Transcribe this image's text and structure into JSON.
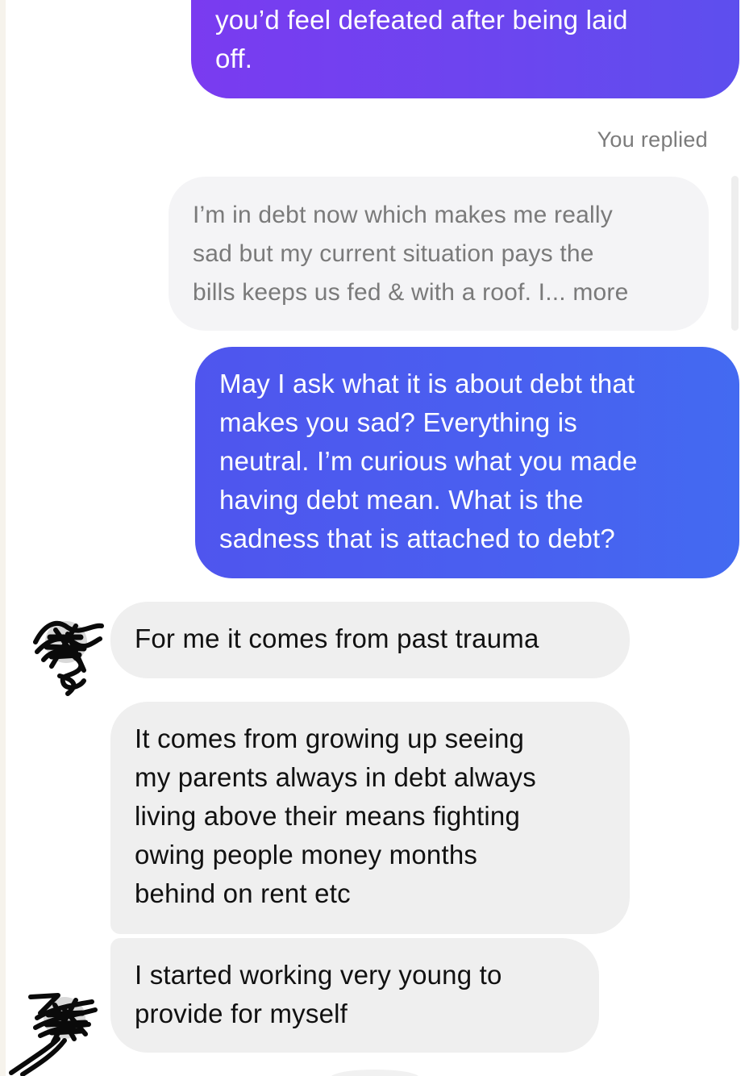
{
  "conversation": {
    "messages": [
      {
        "sender": "me",
        "text": "you’d feel defeated after being laid\noff."
      },
      {
        "sender": "me",
        "kind": "reply-quote",
        "label": "You replied",
        "text": "I’m in debt now which makes me really\nsad but my current situation pays the\nbills keeps us fed & with a roof. I... more"
      },
      {
        "sender": "me",
        "text": "May I ask what it is about debt that\nmakes you sad? Everything is\nneutral. I’m curious what you made\nhaving debt mean. What is the\nsadness that is attached to debt?"
      },
      {
        "sender": "them",
        "text": "For me it comes from past trauma"
      },
      {
        "sender": "them",
        "text": "It comes from growing up seeing\nmy parents always in debt always\nliving above their means fighting\nowing people money months\nbehind on rent etc"
      },
      {
        "sender": "them",
        "text": "I started working very young to\nprovide for myself"
      }
    ]
  },
  "colors": {
    "outgoing_top": "#6b46ef",
    "outgoing_bottom": "#4960f0",
    "incoming": "#efefef",
    "quoted": "#f4f4f6"
  },
  "icons": {
    "avatar": "scribbled-avatar-icon"
  }
}
